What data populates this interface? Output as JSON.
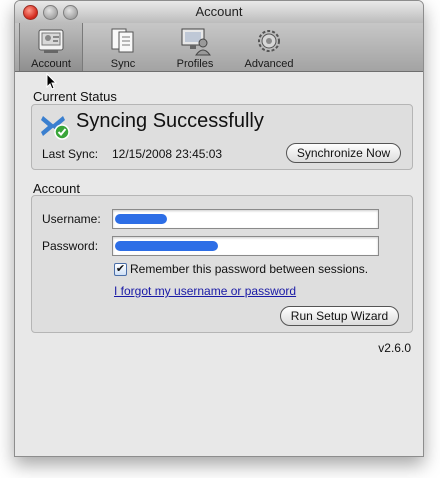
{
  "window": {
    "title": "Account"
  },
  "toolbar": {
    "items": [
      {
        "label": "Account",
        "icon": "account-icon",
        "selected": true
      },
      {
        "label": "Sync",
        "icon": "sync-docs-icon"
      },
      {
        "label": "Profiles",
        "icon": "profiles-icon"
      },
      {
        "label": "Advanced",
        "icon": "gear-icon"
      }
    ]
  },
  "status": {
    "section_title": "Current Status",
    "message": "Syncing Successfully",
    "last_sync_label": "Last Sync:",
    "last_sync_value": "12/15/2008 23:45:03",
    "sync_button": "Synchronize Now"
  },
  "account": {
    "section_title": "Account",
    "username_label": "Username:",
    "password_label": "Password:",
    "remember_label": "Remember this password between sessions.",
    "remember_checked": true,
    "forgot_link": "I forgot my username or password",
    "wizard_button": "Run Setup Wizard"
  },
  "version": "v2.6.0",
  "colors": {
    "redaction": "#2d6ee6",
    "link": "#1a1aa6"
  }
}
